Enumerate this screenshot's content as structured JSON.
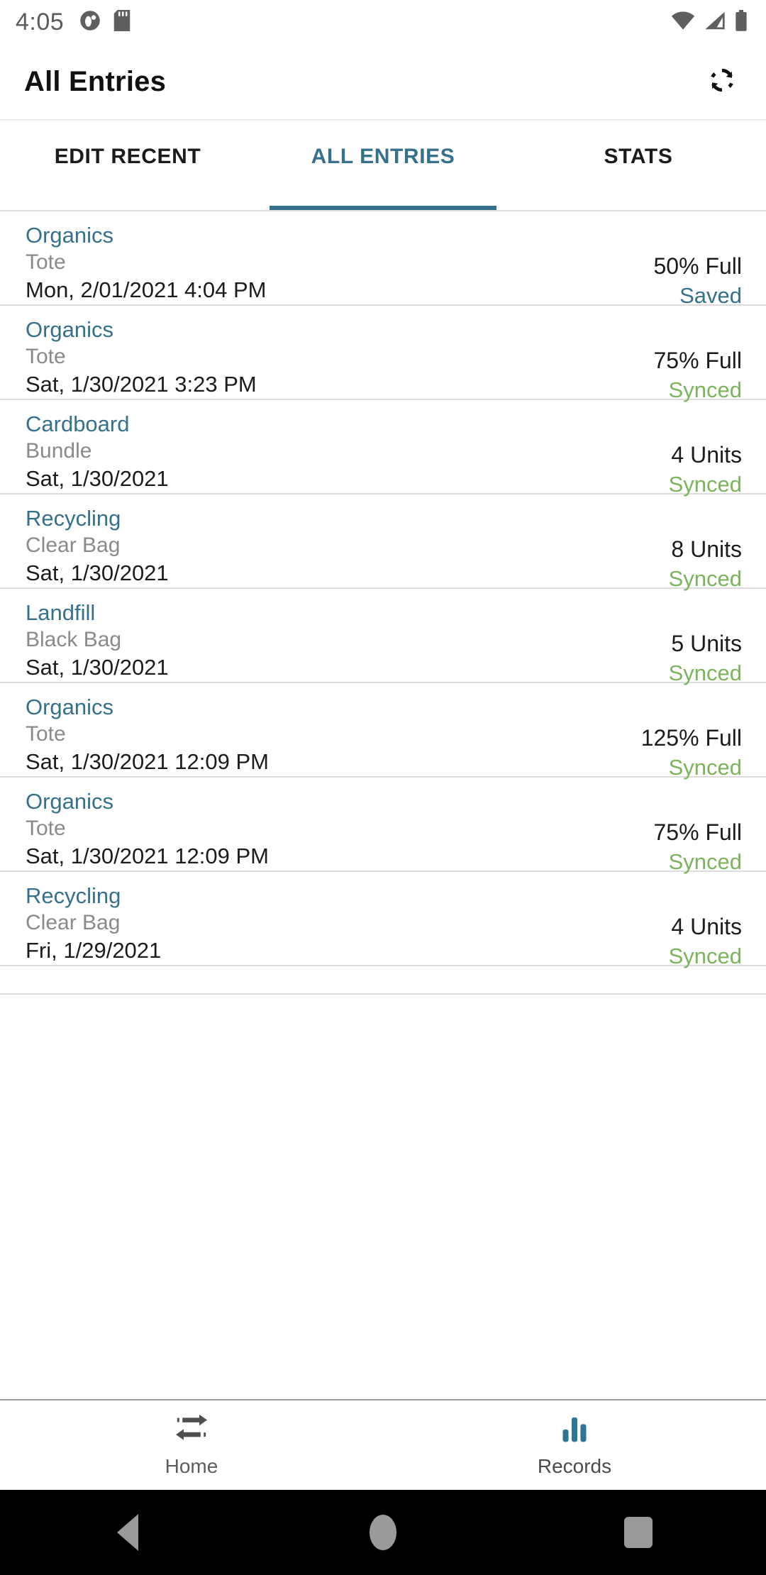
{
  "status_bar": {
    "time": "4:05",
    "left_icons": [
      "app-notification-icon",
      "sd-card-icon"
    ],
    "right_icons": [
      "wifi-icon",
      "cellular-signal-icon",
      "battery-icon"
    ]
  },
  "app_bar": {
    "title": "All Entries",
    "refresh_icon": "refresh-icon"
  },
  "tabs": [
    {
      "label": "EDIT RECENT",
      "active": false
    },
    {
      "label": "ALL ENTRIES",
      "active": true
    },
    {
      "label": "STATS",
      "active": false
    }
  ],
  "colors": {
    "accent_teal": "#35718c",
    "synced_green": "#7ab55c",
    "muted_gray": "#8a8a8a"
  },
  "entries": [
    {
      "category": "Organics",
      "container": "Tote",
      "date": "Mon, 2/01/2021 4:04 PM",
      "amount": "50% Full",
      "status": "Saved",
      "status_kind": "saved"
    },
    {
      "category": "Organics",
      "container": "Tote",
      "date": "Sat, 1/30/2021 3:23 PM",
      "amount": "75% Full",
      "status": "Synced",
      "status_kind": "synced"
    },
    {
      "category": "Cardboard",
      "container": "Bundle",
      "date": "Sat, 1/30/2021",
      "amount": "4 Units",
      "status": "Synced",
      "status_kind": "synced"
    },
    {
      "category": "Recycling",
      "container": "Clear Bag",
      "date": "Sat, 1/30/2021",
      "amount": "8 Units",
      "status": "Synced",
      "status_kind": "synced"
    },
    {
      "category": "Landfill",
      "container": "Black Bag",
      "date": "Sat, 1/30/2021",
      "amount": "5 Units",
      "status": "Synced",
      "status_kind": "synced"
    },
    {
      "category": "Organics",
      "container": "Tote",
      "date": "Sat, 1/30/2021 12:09 PM",
      "amount": "125% Full",
      "status": "Synced",
      "status_kind": "synced"
    },
    {
      "category": "Organics",
      "container": "Tote",
      "date": "Sat, 1/30/2021 12:09 PM",
      "amount": "75% Full",
      "status": "Synced",
      "status_kind": "synced"
    },
    {
      "category": "Recycling",
      "container": "Clear Bag",
      "date": "Fri, 1/29/2021",
      "amount": "4 Units",
      "status": "Synced",
      "status_kind": "synced"
    }
  ],
  "bottom_nav": [
    {
      "label": "Home",
      "icon": "exchange-arrows-icon",
      "active": false
    },
    {
      "label": "Records",
      "icon": "bar-chart-icon",
      "active": true
    }
  ],
  "system_nav": {
    "back": "back-triangle-icon",
    "home": "home-circle-icon",
    "recents": "recents-square-icon"
  }
}
